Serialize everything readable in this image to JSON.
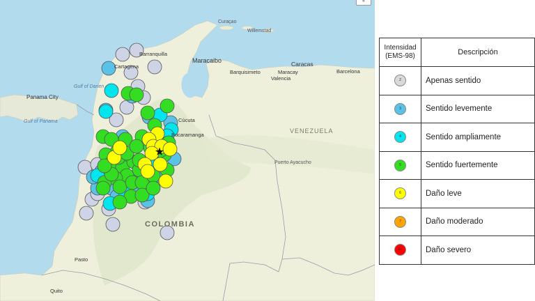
{
  "map": {
    "labels": {
      "curacao": "Curaçao",
      "willemstad": "Willemstad",
      "barranquilla": "Barranquilla",
      "cartagena": "Cartagena",
      "maracaibo": "Maracaibo",
      "caracas": "Caracas",
      "barquisimeto": "Barquisimeto",
      "maracay": "Maracay",
      "valencia": "Valencia",
      "barcelona": "Barcelona",
      "panama_city": "Panama City",
      "gulf_darien": "Gulf of Darien",
      "gulf_panama": "Gulf of Panama",
      "cucuta": "Cúcuta",
      "bucaramanga": "Bucaramanga",
      "venezuela": "VENEZUELA",
      "puerto_ayacucho": "Puerto Ayacucho",
      "colombia": "COLOMBIA",
      "pasto": "Pasto",
      "quito": "Quito"
    },
    "widget_label": "«"
  },
  "legend": {
    "header_intensity": "Intensidad (EMS-98)",
    "header_description": "Descripción",
    "rows": [
      {
        "code": "2",
        "color": "#d9d9d9",
        "label": "Apenas sentido"
      },
      {
        "code": "3",
        "color": "#5bc2e7",
        "label": "Sentido levemente"
      },
      {
        "code": "4",
        "color": "#00e5ee",
        "label": "Sentido ampliamente"
      },
      {
        "code": "5",
        "color": "#33dd22",
        "label": "Sentido fuertemente"
      },
      {
        "code": "6",
        "color": "#ffff00",
        "label": "Daño leve"
      },
      {
        "code": "7",
        "color": "#ffa500",
        "label": "Daño moderado"
      },
      {
        "code": "8+",
        "color": "#ff0000",
        "label": "Daño severo"
      }
    ]
  },
  "reports": {
    "epicenter_icon": "black-star-icon",
    "symbol_colors": {
      "2": "#cfd3e6",
      "3": "#5bc2e7",
      "4": "#00e5ee",
      "5": "#33dd22",
      "6": "#ffff00"
    }
  }
}
